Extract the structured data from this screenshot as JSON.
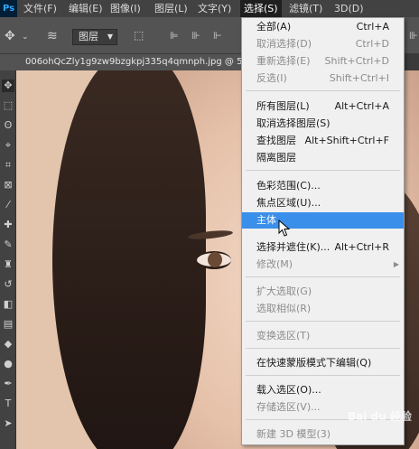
{
  "menubar": {
    "logo": "Ps",
    "items": [
      {
        "label": "文件(F)"
      },
      {
        "label": "编辑(E)"
      },
      {
        "label": "图像(I)"
      },
      {
        "label": "图层(L)"
      },
      {
        "label": "文字(Y)"
      },
      {
        "label": "选择(S)"
      },
      {
        "label": "滤镜(T)"
      },
      {
        "label": "3D(D)"
      }
    ],
    "active": "选择(S)"
  },
  "options_bar": {
    "layer_select": "图层"
  },
  "document": {
    "tab_title": "006ohQcZly1g9zw9bzgkpj335q4qmnph.jpg @ 5..."
  },
  "select_menu": {
    "items": [
      {
        "label": "全部(A)",
        "shortcut": "Ctrl+A",
        "enabled": true
      },
      {
        "label": "取消选择(D)",
        "shortcut": "Ctrl+D",
        "enabled": false
      },
      {
        "label": "重新选择(E)",
        "shortcut": "Shift+Ctrl+D",
        "enabled": false
      },
      {
        "label": "反选(I)",
        "shortcut": "Shift+Ctrl+I",
        "enabled": false
      },
      {
        "label": "所有图层(L)",
        "shortcut": "Alt+Ctrl+A",
        "enabled": true
      },
      {
        "label": "取消选择图层(S)",
        "shortcut": "",
        "enabled": true
      },
      {
        "label": "查找图层",
        "shortcut": "Alt+Shift+Ctrl+F",
        "enabled": true
      },
      {
        "label": "隔离图层",
        "shortcut": "",
        "enabled": true
      },
      {
        "label": "色彩范围(C)...",
        "shortcut": "",
        "enabled": true
      },
      {
        "label": "焦点区域(U)...",
        "shortcut": "",
        "enabled": true
      },
      {
        "label": "主体",
        "shortcut": "",
        "enabled": true,
        "highlighted": true
      },
      {
        "label": "选择并遮住(K)...",
        "shortcut": "Alt+Ctrl+R",
        "enabled": true
      },
      {
        "label": "修改(M)",
        "shortcut": "",
        "enabled": false,
        "submenu": true
      },
      {
        "label": "扩大选取(G)",
        "shortcut": "",
        "enabled": false
      },
      {
        "label": "选取相似(R)",
        "shortcut": "",
        "enabled": false
      },
      {
        "label": "变换选区(T)",
        "shortcut": "",
        "enabled": false
      },
      {
        "label": "在快速蒙版模式下编辑(Q)",
        "shortcut": "",
        "enabled": true
      },
      {
        "label": "载入选区(O)...",
        "shortcut": "",
        "enabled": true
      },
      {
        "label": "存储选区(V)...",
        "shortcut": "",
        "enabled": false
      },
      {
        "label": "新建 3D 模型(3)",
        "shortcut": "",
        "enabled": false
      }
    ]
  },
  "watermark": "Bai du 经验",
  "colors": {
    "highlight": "#3a8fea",
    "menu_bg": "#f0f0f0",
    "app_bg": "#535353"
  }
}
